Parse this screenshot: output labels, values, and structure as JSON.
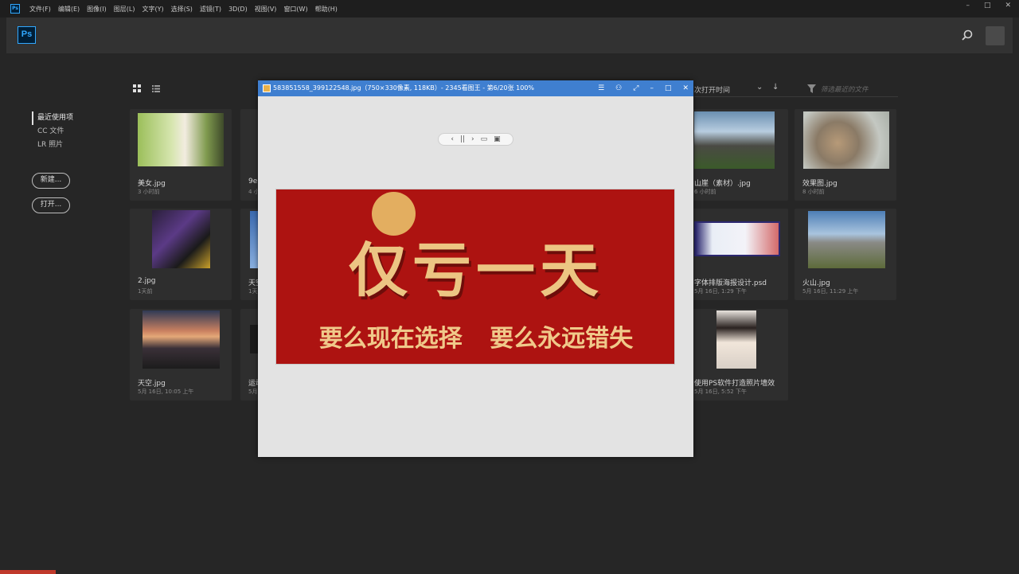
{
  "menubar": {
    "items": [
      "文件(F)",
      "编辑(E)",
      "图像(I)",
      "图层(L)",
      "文字(Y)",
      "选择(S)",
      "滤镜(T)",
      "3D(D)",
      "视图(V)",
      "窗口(W)",
      "帮助(H)"
    ],
    "ps_icon": "Ps",
    "window_controls": [
      "–",
      "□",
      "✕"
    ]
  },
  "header": {
    "logo": "Ps",
    "search_icon": "search-icon"
  },
  "leftnav": {
    "items": [
      "最近使用项",
      "CC 文件",
      "LR 照片"
    ],
    "new_button": "新建...",
    "open_button": "打开..."
  },
  "sort": {
    "label": "次打开时间",
    "filter_placeholder": "筛选最近的文件"
  },
  "files": [
    {
      "name": "美女.jpg",
      "time": "3 小时前"
    },
    {
      "name": "9e",
      "time": "4 小"
    },
    {
      "name": "山崖（素材）.jpg",
      "time": "6 小时前"
    },
    {
      "name": "效果图.jpg",
      "time": "8 小时前"
    },
    {
      "name": "2.jpg",
      "time": "1天前"
    },
    {
      "name": "天空",
      "time": "1天"
    },
    {
      "name": "字体排版海报设计.psd",
      "time": "5月 16日, 1:29 下午"
    },
    {
      "name": "火山.jpg",
      "time": "5月 16日, 11:29 上午"
    },
    {
      "name": "天空.jpg",
      "time": "5月 16日, 10:05 上午"
    },
    {
      "name": "运动",
      "time": "5月"
    },
    {
      "name": "使用PS软件打造照片墙效",
      "time": "5月 16日, 5:52 下午"
    }
  ],
  "viewer": {
    "title": "583851558_399122548.jpg（750×330像素, 118KB）- 2345看图王 - 第6/20张 100%",
    "controls": [
      "☰",
      "⚇",
      "⤢",
      "–",
      "□",
      "✕"
    ],
    "toolbar": [
      "‹",
      "||",
      "›",
      "▭",
      "▣"
    ],
    "banner_headline": "仅亏一天",
    "banner_sub": "要么现在选择 要么永远错失"
  },
  "colors": {
    "accent": "#31a8ff",
    "viewer_title": "#3f7fd0",
    "banner_bg": "#ad1311",
    "banner_text": "#ecc583"
  }
}
